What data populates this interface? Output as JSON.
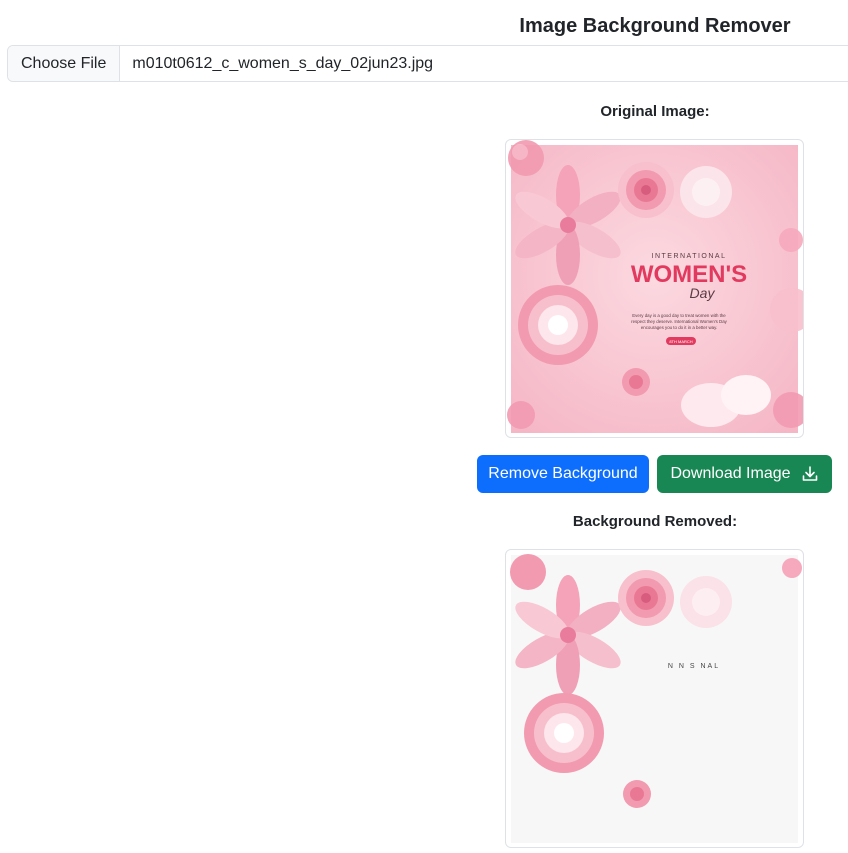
{
  "header": {
    "title": "Image Background Remover"
  },
  "file_input": {
    "button_label": "Choose File",
    "file_name": "m010t0612_c_women_s_day_02jun23.jpg"
  },
  "original": {
    "label": "Original Image:",
    "poster": {
      "line1": "INTERNATIONAL",
      "line2": "WOMEN'S",
      "line3": "Day",
      "body1": "Every day is a good day to treat women with the",
      "body2": "respect they deserve. International Women's Day",
      "body3": "encourages you to do it in a better way.",
      "badge": "8TH MARCH"
    }
  },
  "actions": {
    "remove_label": "Remove Background",
    "download_label": "Download Image",
    "download_icon": "download-icon"
  },
  "result": {
    "label": "Background Removed:",
    "residual_text": "N   N S   NAL"
  },
  "colors": {
    "primary": "#0d6efd",
    "success": "#198754",
    "poster_bg": "#f8c3cf",
    "accent": "#e23a5f"
  }
}
